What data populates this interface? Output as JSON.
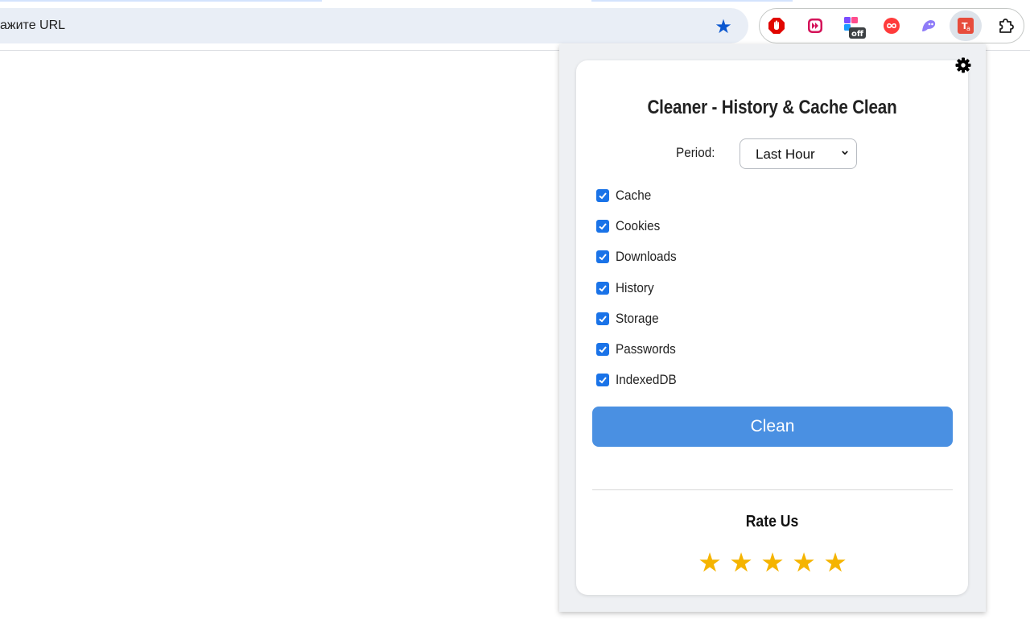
{
  "browser": {
    "omnibox_placeholder": "ажите URL",
    "extensions": [
      {
        "name": "adblock-icon",
        "color": "#e10600"
      },
      {
        "name": "video-speed-icon",
        "color": "#d4145a"
      },
      {
        "name": "tab-manager-icon",
        "badge": "off"
      },
      {
        "name": "infinity-icon",
        "color": "#ff3b3b"
      },
      {
        "name": "ghost-icon",
        "color": "#8f7cf8"
      },
      {
        "name": "translator-icon",
        "color": "#e74c3c"
      },
      {
        "name": "extensions-puzzle-icon"
      }
    ]
  },
  "popup": {
    "title": "Cleaner - History & Cache Clean",
    "period_label": "Period:",
    "period_value": "Last Hour",
    "options": [
      {
        "label": "Cache",
        "checked": true
      },
      {
        "label": "Cookies",
        "checked": true
      },
      {
        "label": "Downloads",
        "checked": true
      },
      {
        "label": "History",
        "checked": true
      },
      {
        "label": "Storage",
        "checked": true
      },
      {
        "label": "Passwords",
        "checked": true
      },
      {
        "label": "IndexedDB",
        "checked": true
      }
    ],
    "clean_label": "Clean",
    "rate_title": "Rate Us",
    "stars": [
      "★",
      "★",
      "★",
      "★",
      "★"
    ],
    "accent_color": "#4a90e2",
    "star_color": "#f5b400"
  }
}
